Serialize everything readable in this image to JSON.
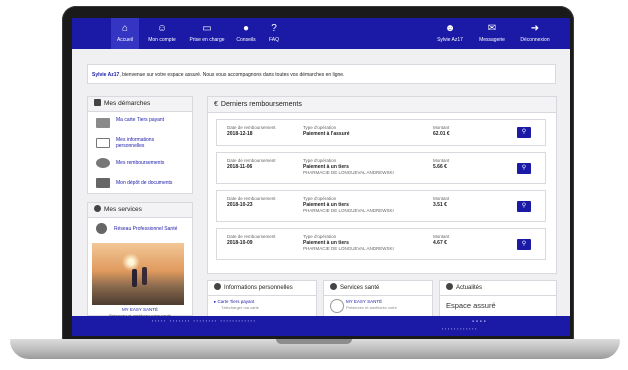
{
  "nav": {
    "left": [
      {
        "label": "Accueil",
        "icon": "home-icon",
        "glyph": "⌂"
      },
      {
        "label": "Mon compte",
        "icon": "users-icon",
        "glyph": "☺"
      },
      {
        "label": "Prise en charge",
        "icon": "monitor-icon",
        "glyph": "▭"
      },
      {
        "label": "Conseils",
        "icon": "chat-icon",
        "glyph": "●"
      },
      {
        "label": "FAQ",
        "icon": "question-icon",
        "glyph": "?"
      }
    ],
    "right": [
      {
        "label": "Sylvie Az17",
        "icon": "user-icon",
        "glyph": "☻"
      },
      {
        "label": "Messagerie",
        "icon": "mail-icon",
        "glyph": "✉"
      },
      {
        "label": "Déconnexion",
        "icon": "logout-icon",
        "glyph": "➜"
      }
    ]
  },
  "welcome": {
    "name": "Sylvie Az17",
    "text": ", bienvenue sur votre espace assuré. Nous vous accompagnons dans toutes vos démarches en ligne."
  },
  "demarches": {
    "title": "Mes démarches",
    "items": [
      "Ma carte Tiers payant",
      "Mes informations personnelles",
      "Mes remboursements",
      "Mon dépôt de documents"
    ]
  },
  "services": {
    "title": "Mes services",
    "item": "Réseau Professionnel Santé",
    "promo_title": "MY EASY SANTÉ",
    "promo_text": "Préservez et améliorez votre santé"
  },
  "remboursements": {
    "title": "Derniers remboursements",
    "labels": {
      "date": "Date de remboursement",
      "type": "Type d'opération",
      "amount": "Montant"
    },
    "rows": [
      {
        "date": "2018-12-18",
        "type": "Paiement à l'assuré",
        "payee": "",
        "amount": "62.01 €"
      },
      {
        "date": "2018-11-06",
        "type": "Paiement à un tiers",
        "payee": "PHARMACIE DE LONGUEVAL ANDREWSKI",
        "amount": "5.66 €"
      },
      {
        "date": "2018-10-23",
        "type": "Paiement à un tiers",
        "payee": "PHARMACIE DE LONGUEVAL ANDREWSKI",
        "amount": "3.51 €"
      },
      {
        "date": "2018-10-09",
        "type": "Paiement à un tiers",
        "payee": "PHARMACIE DE LONGUEVAL ANDREWSKI",
        "amount": "4.67 €"
      }
    ]
  },
  "infos": {
    "title": "Informations personnelles",
    "link": "Carte Tiers payant",
    "sub": "Télécharger ma carte"
  },
  "sante": {
    "title": "Services santé",
    "link": "MY EASY SANTÉ",
    "sub": "Préservez et améliorez votre"
  },
  "actus": {
    "title": "Actualités",
    "headline": "Espace assuré"
  },
  "colors": {
    "brand": "#1a1aa6"
  }
}
